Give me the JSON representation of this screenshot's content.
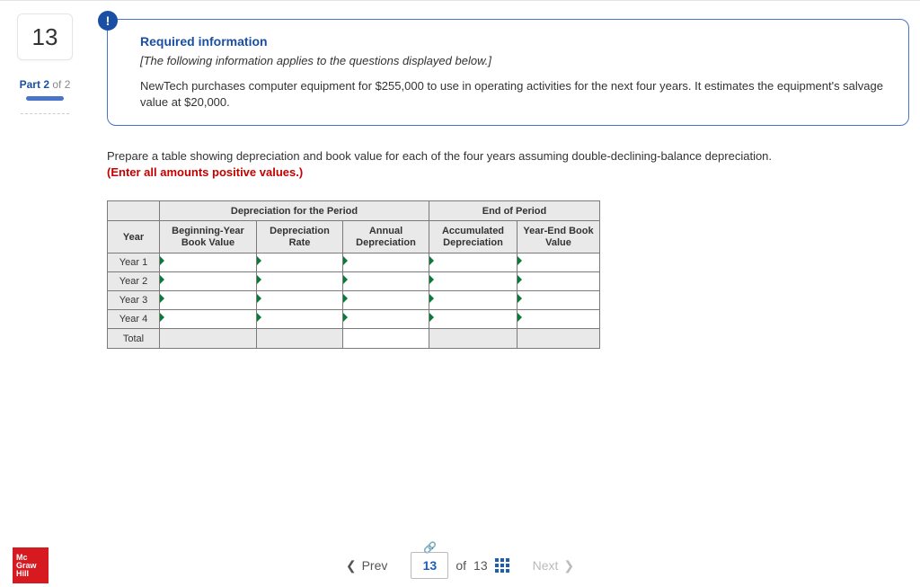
{
  "sidebar": {
    "question_number": "13",
    "part_prefix": "Part ",
    "part_current": "2",
    "part_of_word": " of ",
    "part_total": "2"
  },
  "info": {
    "badge": "!",
    "title": "Required information",
    "subtitle": "[The following information applies to the questions displayed below.]",
    "body": "NewTech purchases computer equipment for $255,000 to use in operating activities for the next four years. It estimates the equipment's salvage value at $20,000."
  },
  "prompt": {
    "line1": "Prepare a table showing depreciation and book value for each of the four years assuming double-declining-balance depreciation.",
    "line2": "(Enter all amounts positive values.)"
  },
  "table": {
    "group_dep": "Depreciation for the Period",
    "group_end": "End of Period",
    "headers": {
      "year": "Year",
      "beg_bv": "Beginning-Year Book Value",
      "rate": "Depreciation Rate",
      "annual": "Annual Depreciation",
      "acc": "Accumulated Depreciation",
      "end_bv": "Year-End Book Value"
    },
    "rows": [
      "Year 1",
      "Year 2",
      "Year 3",
      "Year 4"
    ],
    "total_label": "Total"
  },
  "footer": {
    "logo": {
      "l1": "Mc",
      "l2": "Graw",
      "l3": "Hill"
    },
    "prev": "Prev",
    "next": "Next",
    "page_current": "13",
    "page_of_word": "of",
    "page_total": "13"
  }
}
